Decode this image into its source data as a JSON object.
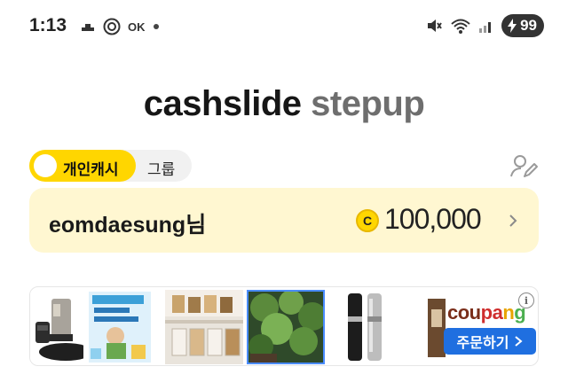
{
  "status_bar": {
    "time": "1:13",
    "ok_label": "OK",
    "battery_level": "99",
    "icons": [
      "cloud-icon",
      "vpn-icon",
      "dot-icon",
      "mute-icon",
      "wifi-icon",
      "signal-icon",
      "charging-icon"
    ]
  },
  "app": {
    "title_main": "cashslide",
    "title_sub": "stepup"
  },
  "tabs": {
    "personal_label": "개인캐시",
    "group_label": "그룹"
  },
  "account": {
    "username": "eomdaesung님",
    "coin_symbol": "C",
    "balance": "100,000"
  },
  "ad": {
    "brand": "coupang",
    "order_label": "주문하기",
    "info_symbol": "i",
    "products": [
      "salt-grinder",
      "book-cover",
      "storage-containers",
      "plant-photo",
      "pepper-grinders",
      "partial-product"
    ]
  },
  "colors": {
    "accent_yellow": "#ffd600",
    "card_background": "#fff7d1",
    "coupang_blue": "#1f6fe0"
  }
}
